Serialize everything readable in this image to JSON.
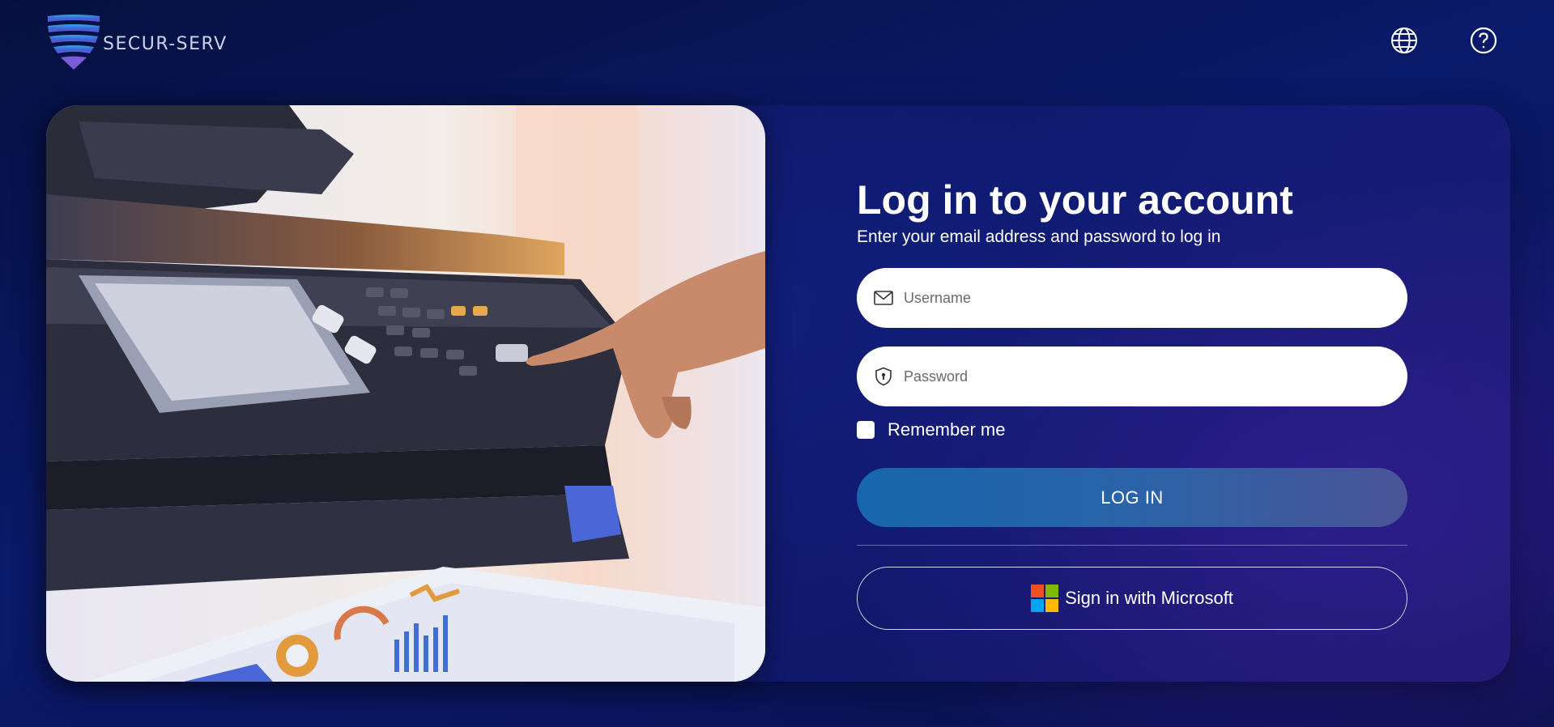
{
  "brand": {
    "name": "SECUR-SERV",
    "logo_icon": "shield-logo"
  },
  "topbar": {
    "language_icon": "globe-icon",
    "help_icon": "question-circle-icon"
  },
  "login": {
    "title": "Log in to your account",
    "subtitle": "Enter your email address and password to log in",
    "username_placeholder": "Username",
    "password_placeholder": "Password",
    "username_icon": "envelope-icon",
    "password_icon": "shield-lock-icon",
    "remember_label": "Remember me",
    "remember_checked": false,
    "login_label": "LOG IN",
    "microsoft_label": "Sign in with Microsoft"
  },
  "colors": {
    "background": "#0a1a6a",
    "login_button_start": "#1766ad",
    "login_button_end": "#4a5496",
    "microsoft_red": "#f25022",
    "microsoft_green": "#7fba00",
    "microsoft_blue": "#00a4ef",
    "microsoft_yellow": "#ffb900"
  }
}
